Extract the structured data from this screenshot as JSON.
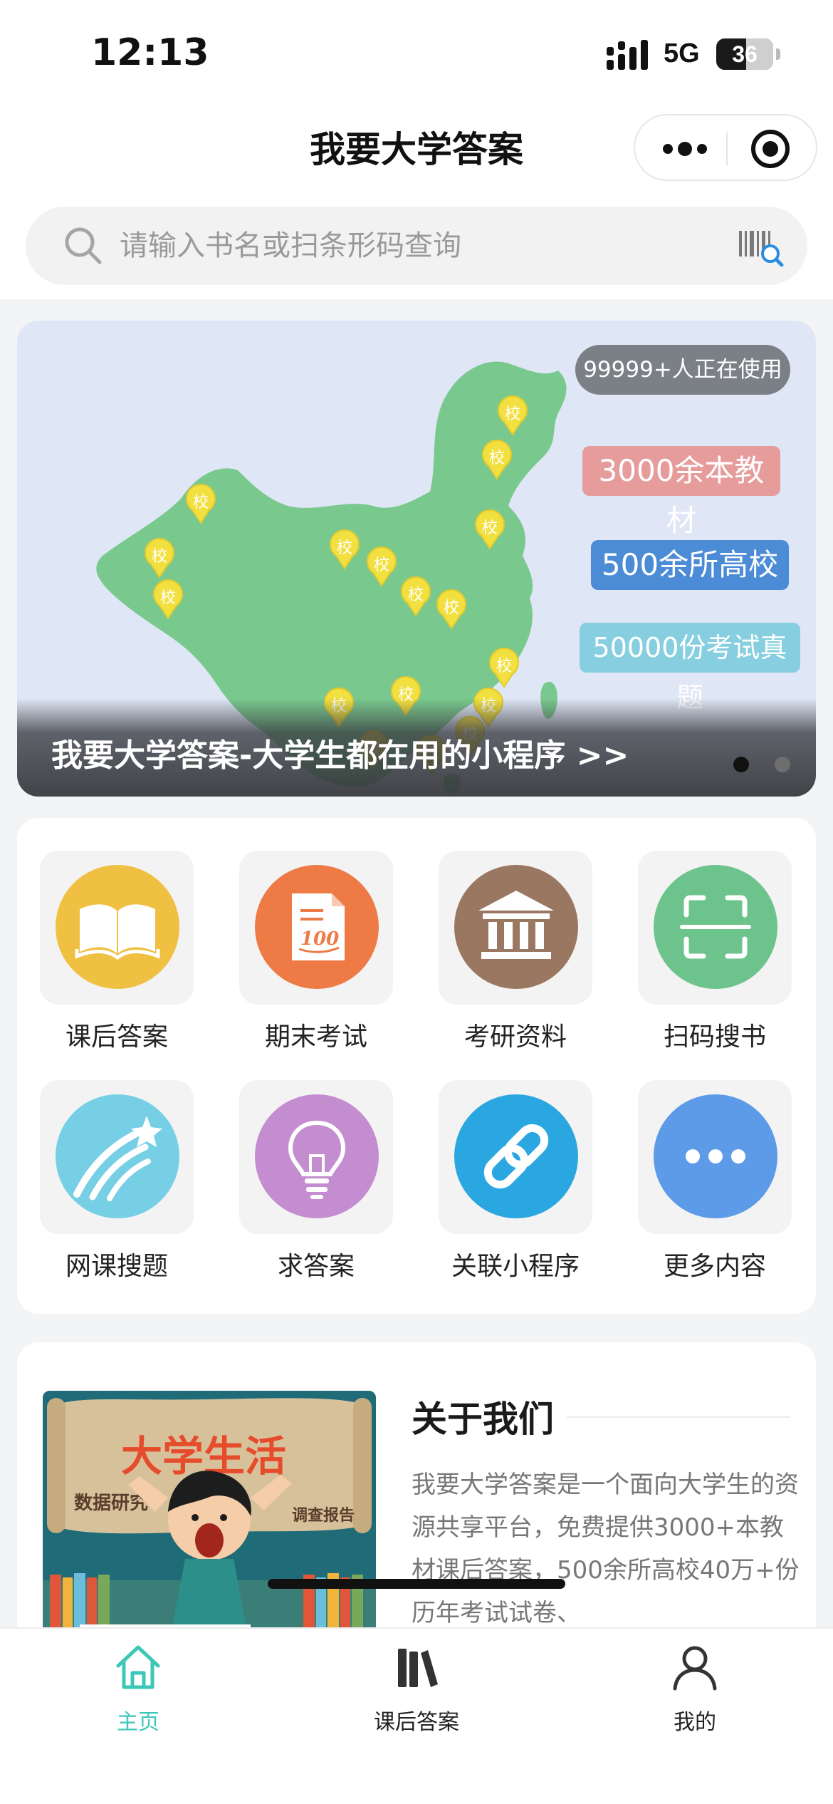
{
  "status_bar": {
    "time": "12:13",
    "network": "5G",
    "battery": "36"
  },
  "header": {
    "title": "我要大学答案"
  },
  "search": {
    "placeholder": "请输入书名或扫条形码查询"
  },
  "banner": {
    "users_badge": "99999+人正在使用",
    "stats": [
      "3000余本教材",
      "500余所高校",
      "50000份考试真题"
    ],
    "caption": "我要大学答案-大学生都在用的小程序 >>",
    "marker_label": "校",
    "active_slide": 1,
    "slide_count": 2
  },
  "grid": {
    "items": [
      {
        "label": "课后答案",
        "icon": "open-book-icon",
        "color": "#f0c043"
      },
      {
        "label": "期末考试",
        "icon": "exam-paper-icon",
        "color": "#ee7a45"
      },
      {
        "label": "考研资料",
        "icon": "institution-icon",
        "color": "#9a7760"
      },
      {
        "label": "扫码搜书",
        "icon": "scan-icon",
        "color": "#6cc38c"
      },
      {
        "label": "网课搜题",
        "icon": "shooting-star-icon",
        "color": "#77cfe6"
      },
      {
        "label": "求答案",
        "icon": "lightbulb-icon",
        "color": "#c38dd0"
      },
      {
        "label": "关联小程序",
        "icon": "link-icon",
        "color": "#2aa7e0"
      },
      {
        "label": "更多内容",
        "icon": "more-dots-icon",
        "color": "#5d9ae8"
      }
    ]
  },
  "about": {
    "title": "关于我们",
    "text": "我要大学答案是一个面向大学生的资源共享平台，免费提供3000+本教材课后答案，500余所高校40万+份历年考试试卷、",
    "image_title": "大学生活",
    "image_left_label": "数据研究",
    "image_right_label": "调查报告"
  },
  "tab_bar": {
    "tabs": [
      {
        "label": "主页",
        "icon": "home-icon",
        "active": true
      },
      {
        "label": "课后答案",
        "icon": "books-icon",
        "active": false
      },
      {
        "label": "我的",
        "icon": "user-icon",
        "active": false
      }
    ],
    "active_color": "#3cc7b8",
    "inactive_color": "#222222"
  }
}
